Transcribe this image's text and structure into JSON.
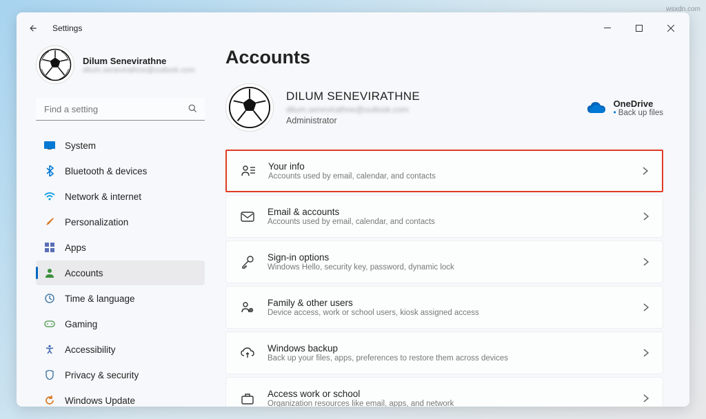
{
  "app_title": "Settings",
  "profile": {
    "name": "Dilum Senevirathne",
    "email": "dilum.senevirathne@outlook.com"
  },
  "search": {
    "placeholder": "Find a setting"
  },
  "nav": {
    "items": [
      {
        "label": "System"
      },
      {
        "label": "Bluetooth & devices"
      },
      {
        "label": "Network & internet"
      },
      {
        "label": "Personalization"
      },
      {
        "label": "Apps"
      },
      {
        "label": "Accounts"
      },
      {
        "label": "Time & language"
      },
      {
        "label": "Gaming"
      },
      {
        "label": "Accessibility"
      },
      {
        "label": "Privacy & security"
      },
      {
        "label": "Windows Update"
      }
    ]
  },
  "page": {
    "title": "Accounts",
    "account_name": "DILUM SENEVIRATHNE",
    "account_email": "dilum.senevirathne@outlook.com",
    "role": "Administrator"
  },
  "onedrive": {
    "title": "OneDrive",
    "sub": "Back up files"
  },
  "cards": [
    {
      "title": "Your info",
      "sub": "Accounts used by email, calendar, and contacts"
    },
    {
      "title": "Email & accounts",
      "sub": "Accounts used by email, calendar, and contacts"
    },
    {
      "title": "Sign-in options",
      "sub": "Windows Hello, security key, password, dynamic lock"
    },
    {
      "title": "Family & other users",
      "sub": "Device access, work or school users, kiosk assigned access"
    },
    {
      "title": "Windows backup",
      "sub": "Back up your files, apps, preferences to restore them across devices"
    },
    {
      "title": "Access work or school",
      "sub": "Organization resources like email, apps, and network"
    }
  ],
  "watermark": "wsxdn.com"
}
